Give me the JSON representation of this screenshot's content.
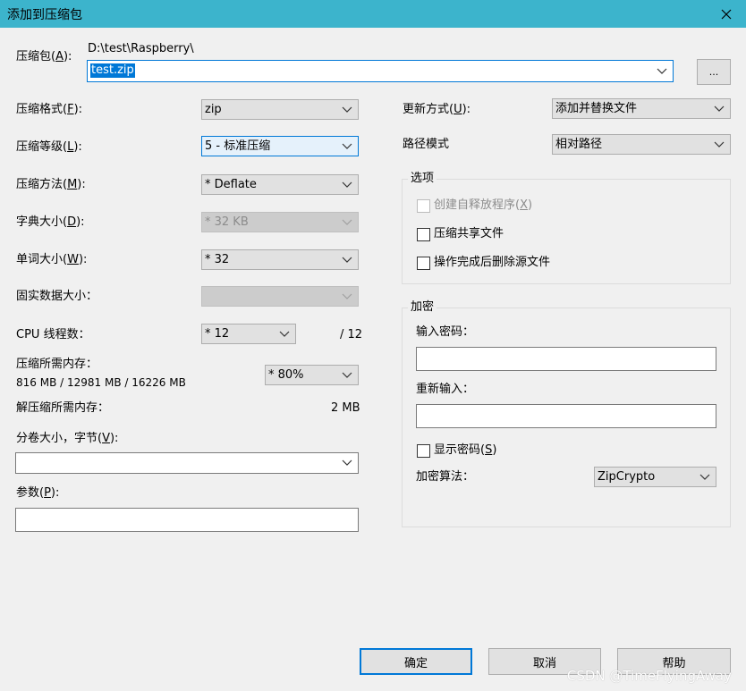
{
  "window": {
    "title": "添加到压缩包"
  },
  "archive": {
    "label": "压缩包(",
    "label_key": "A",
    "label_end": "):",
    "path": "D:\\test\\Raspberry\\",
    "value": "test.zip",
    "browse_label": "..."
  },
  "left": {
    "format": {
      "label": "压缩格式(",
      "key": "F",
      "end": "):",
      "value": "zip"
    },
    "level": {
      "label": "压缩等级(",
      "key": "L",
      "end": "):",
      "value": "5 - 标准压缩"
    },
    "method": {
      "label": "压缩方法(",
      "key": "M",
      "end": "):",
      "value": "*  Deflate"
    },
    "dict": {
      "label": "字典大小(",
      "key": "D",
      "end": "):",
      "value": "*  32 KB"
    },
    "word": {
      "label": "单词大小(",
      "key": "W",
      "end": "):",
      "value": "*  32"
    },
    "solid": {
      "label": "固实数据大小：",
      "value": ""
    },
    "threads": {
      "label": "CPU 线程数：",
      "value": "*  12",
      "max": "/ 12"
    },
    "mem": {
      "label": "压缩所需内存：",
      "detail": "816 MB / 12981 MB / 16226 MB",
      "value": "* 80%"
    },
    "decomp": {
      "label": "解压缩所需内存：",
      "value": "2 MB"
    },
    "volume": {
      "label": "分卷大小，字节(",
      "key": "V",
      "end": "):",
      "value": ""
    },
    "params": {
      "label": "参数(",
      "key": "P",
      "end": "):",
      "value": ""
    }
  },
  "right": {
    "update": {
      "label": "更新方式(",
      "key": "U",
      "end": "):",
      "value": "添加并替换文件"
    },
    "pathmode": {
      "label": "路径模式",
      "value": "相对路径"
    },
    "options": {
      "title": "选项",
      "sfx": {
        "label": "创建自释放程序(",
        "key": "X",
        "end": ")"
      },
      "shared": {
        "label": "压缩共享文件"
      },
      "delete": {
        "label": "操作完成后删除源文件"
      }
    },
    "encrypt": {
      "title": "加密",
      "pw_label": "输入密码：",
      "pw2_label": "重新输入：",
      "show": {
        "label": "显示密码(",
        "key": "S",
        "end": ")"
      },
      "method_label": "加密算法：",
      "method_value": "ZipCrypto"
    }
  },
  "buttons": {
    "ok": "确定",
    "cancel": "取消",
    "help": "帮助"
  },
  "watermark": "CSDN @TimeFlyingAway"
}
